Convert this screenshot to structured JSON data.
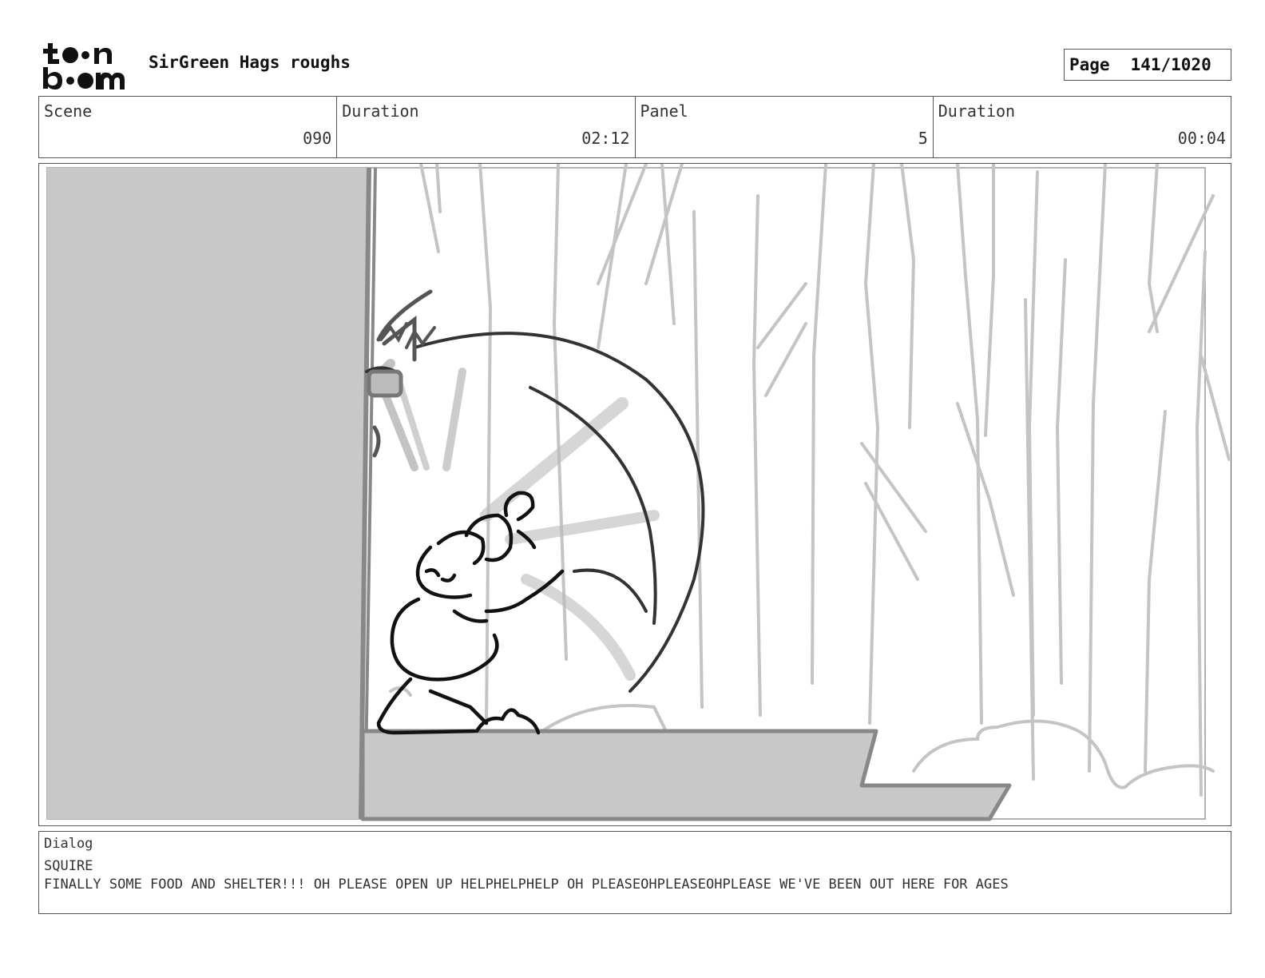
{
  "header": {
    "logo_text": "toonboom",
    "project_title": "SirGreen Hags roughs",
    "page_label": "Page",
    "page_number": "141/1020"
  },
  "info": {
    "scene_label": "Scene",
    "scene_value": "090",
    "scene_duration_label": "Duration",
    "scene_duration_value": "02:12",
    "panel_label": "Panel",
    "panel_value": "5",
    "panel_duration_label": "Duration",
    "panel_duration_value": "00:04"
  },
  "dialog": {
    "label": "Dialog",
    "speaker": "SQUIRE",
    "line": "FINALLY SOME FOOD AND SHELTER!!! OH PLEASE OPEN UP HELPHELPHELP OH PLEASEOHPLEASEOHPLEASE WE'VE BEEN OUT HERE FOR AGES"
  },
  "colors": {
    "frame_border": "#555555",
    "wall_fill": "#c8c8c8",
    "sketch_light": "#c4c4c4",
    "sketch_dark": "#111111"
  }
}
